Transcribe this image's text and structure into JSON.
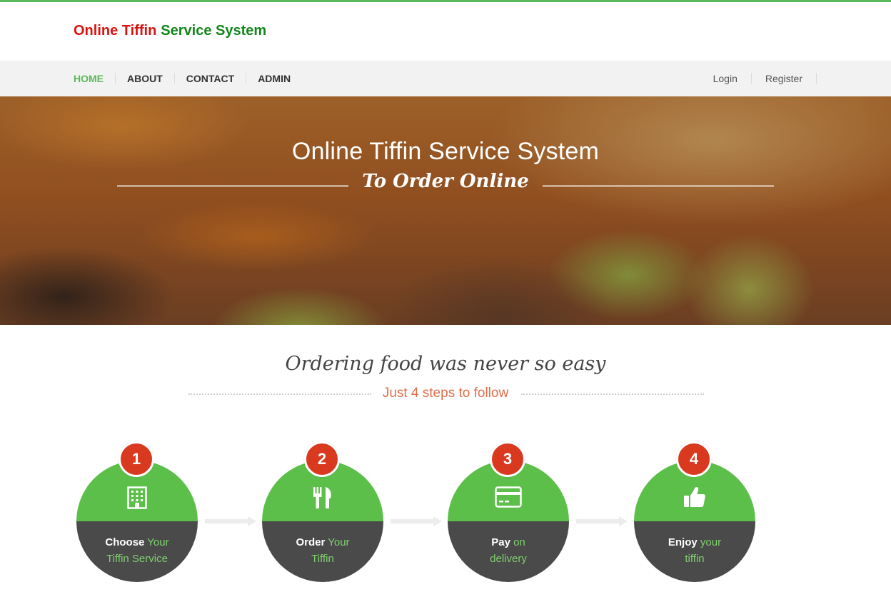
{
  "brand": {
    "part1": "Online Tiffin",
    "part2": "Service System"
  },
  "nav": {
    "items": [
      {
        "label": "HOME"
      },
      {
        "label": "ABOUT"
      },
      {
        "label": "CONTACT"
      },
      {
        "label": "ADMIN"
      }
    ],
    "right": [
      {
        "label": "Login"
      },
      {
        "label": "Register"
      }
    ]
  },
  "hero": {
    "title": "Online Tiffin Service System",
    "subtitle": "To Order Online"
  },
  "section": {
    "title": "Ordering food was never so easy",
    "subtitle": "Just 4 steps to follow"
  },
  "steps": [
    {
      "number": "1",
      "icon": "building-icon",
      "strong": "Choose",
      "soft1": "Your",
      "line2": "Tiffin Service"
    },
    {
      "number": "2",
      "icon": "fork-knife-icon",
      "strong": "Order",
      "soft1": "Your",
      "line2": "Tiffin"
    },
    {
      "number": "3",
      "icon": "credit-card-icon",
      "strong": "Pay",
      "soft1": "on",
      "line2": "delivery"
    },
    {
      "number": "4",
      "icon": "thumbs-up-icon",
      "strong": "Enjoy",
      "soft1": "your",
      "line2": "tiffin"
    }
  ],
  "colors": {
    "accent_green": "#5cb85c",
    "brand_red": "#d9130f",
    "brand_green": "#12861a",
    "badge_red": "#d93a1f",
    "step_dark": "#4a4a4a",
    "subtitle_orange": "#e06d4a"
  }
}
